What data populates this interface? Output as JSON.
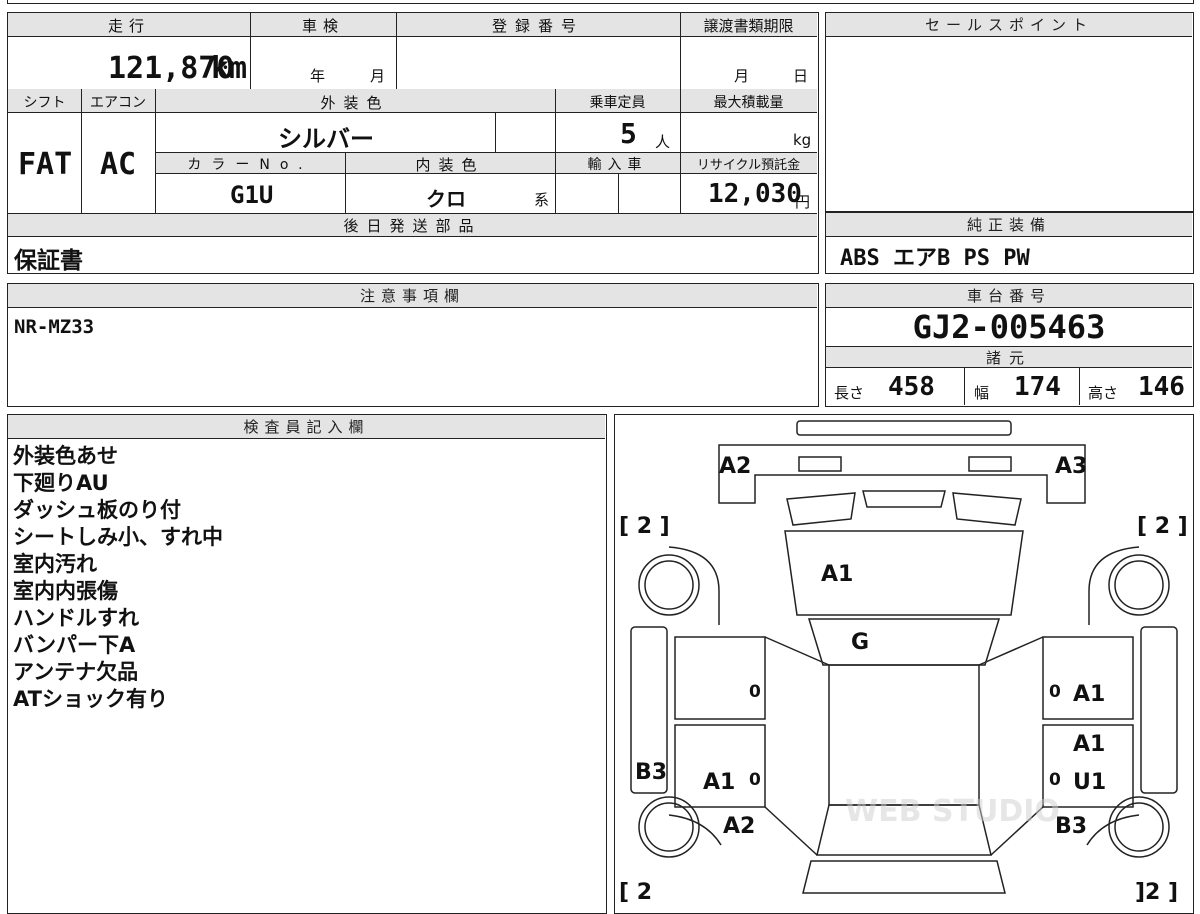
{
  "top_info": {
    "mileage_label": "走行",
    "mileage_value": "121,870",
    "mileage_unit": "km",
    "shaken_label": "車検",
    "shaken_year_unit": "年",
    "shaken_month_unit": "月",
    "reg_label": "登録番号",
    "transfer_label": "譲渡書類期限",
    "transfer_month_unit": "月",
    "transfer_day_unit": "日",
    "shift_label": "シフト",
    "shift_value": "FAT",
    "ac_label": "エアコン",
    "ac_value": "AC",
    "color_label": "外装色",
    "color_value": "シルバー",
    "capacity_label": "乗車定員",
    "capacity_value": "5",
    "capacity_unit": "人",
    "load_label": "最大積載量",
    "load_unit": "kg",
    "color_no_label": "カラーNo.",
    "color_no_value": "G1U",
    "interior_label": "内装色",
    "interior_value": "クロ",
    "interior_unit": "系",
    "import_label": "輸入車",
    "recycle_label": "リサイクル預託金",
    "recycle_value": "12,030",
    "recycle_unit": "円"
  },
  "sales_point": {
    "label": "セールスポイント",
    "value": ""
  },
  "later_parts": {
    "label": "後日発送部品",
    "value": "保証書"
  },
  "genuine_equipment": {
    "label": "純正装備",
    "value": "ABS エアB PS PW"
  },
  "notes": {
    "label": "注意事項欄",
    "value": "NR-MZ33"
  },
  "chassis": {
    "label": "車台番号",
    "value": "GJ2-005463"
  },
  "specs": {
    "label": "諸元",
    "length_label": "長さ",
    "length_value": "458",
    "width_label": "幅",
    "width_value": "174",
    "height_label": "高さ",
    "height_value": "146"
  },
  "inspector": {
    "label": "検査員記入欄",
    "items": [
      "外装色あせ",
      "下廻りAU",
      "ダッシュ板のり付",
      "シートしみ小、すれ中",
      "室内汚れ",
      "室内内張傷",
      "ハンドルすれ",
      "バンパー下A",
      "アンテナ欠品",
      "ATショック有り"
    ]
  },
  "diagram": {
    "marks": {
      "front_left": "A2",
      "front_right": "A3",
      "hood": "A1",
      "windshield": "G",
      "left_front_door_digit": "0",
      "right_front_door_digit": "0",
      "right_front_door": "A1",
      "right_rear_door_top": "A1",
      "left_rear_door": "A1",
      "left_rear_door_digit": "0",
      "right_rear_door_digit": "0",
      "right_rear_door": "U1",
      "left_side": "B3",
      "left_rear": "A2",
      "right_rear": "B3",
      "tire_top_left": "[ 2 ]",
      "tire_top_right": "[ 2 ]",
      "tire_bottom_left": "[ 2",
      "tire_bottom_right": "]2 ]"
    },
    "watermark": "WEB STUDIO"
  }
}
